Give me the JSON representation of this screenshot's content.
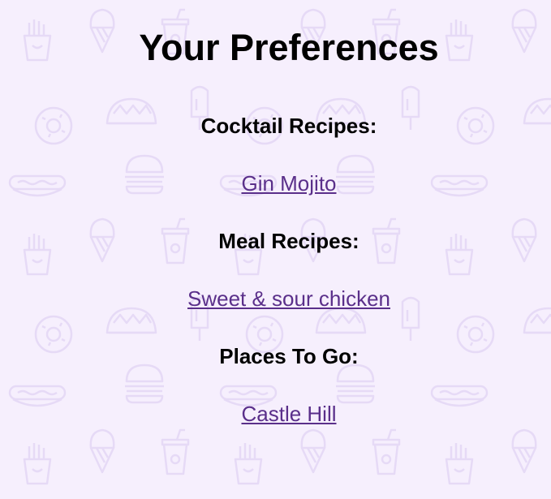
{
  "page": {
    "title": "Your Preferences",
    "background_color": "#f6effd",
    "pattern_color": "#e6daf6",
    "link_color": "#5a2f8a"
  },
  "sections": [
    {
      "heading": "Cocktail Recipes:",
      "link": "Gin Mojito"
    },
    {
      "heading": "Meal Recipes:",
      "link": "Sweet & sour chicken"
    },
    {
      "heading": "Places To Go:",
      "link": "Castle Hill"
    }
  ],
  "background_icons": [
    "fries-icon",
    "ice-cream-icon",
    "soda-cup-icon",
    "taco-icon",
    "donut-icon",
    "popsicle-icon",
    "hotdog-icon",
    "burger-icon"
  ]
}
